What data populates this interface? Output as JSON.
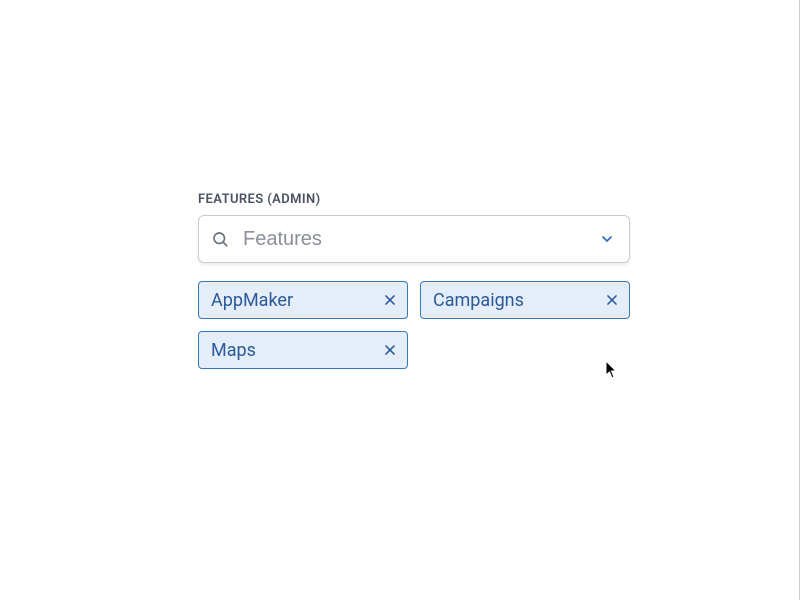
{
  "section_label": "FEATURES (ADMIN)",
  "combo": {
    "placeholder": "Features",
    "value": ""
  },
  "tags": [
    {
      "label": "AppMaker"
    },
    {
      "label": "Campaigns"
    },
    {
      "label": "Maps"
    }
  ],
  "colors": {
    "tag_border": "#357abd",
    "tag_bg": "#e5eef8",
    "tag_text": "#2a5a9a",
    "input_border": "#c9ccd2"
  }
}
